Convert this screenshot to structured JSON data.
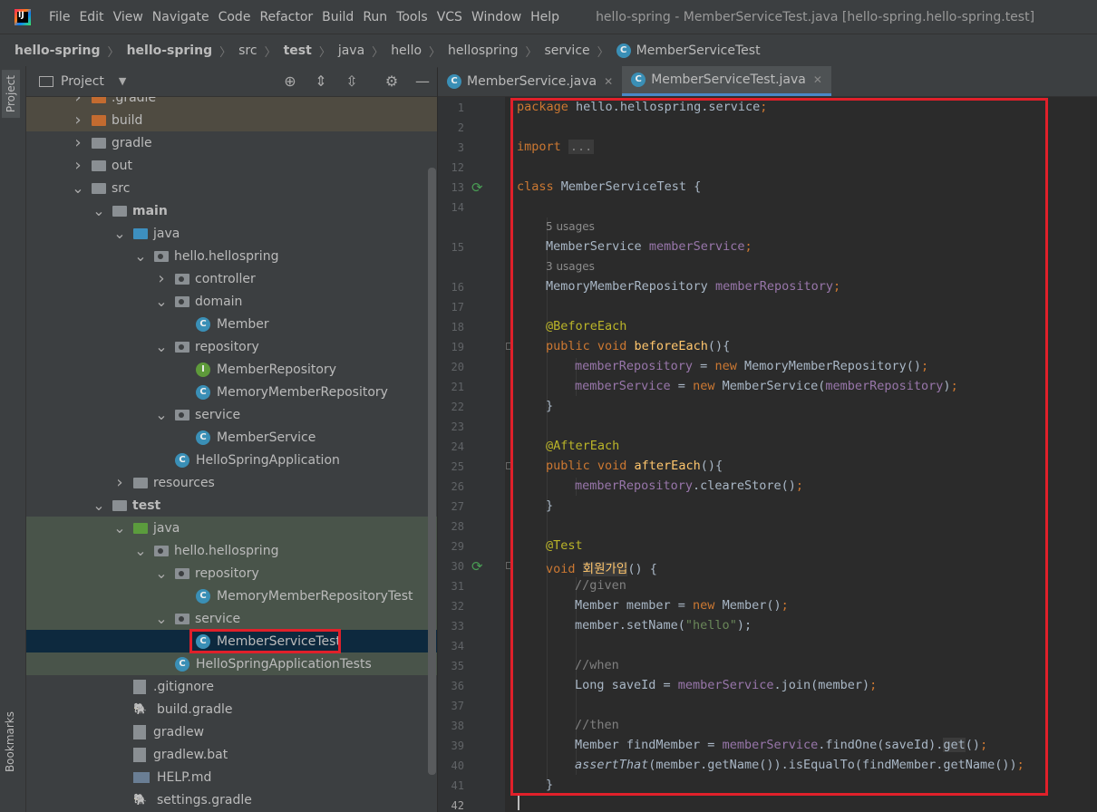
{
  "menu": {
    "items": [
      "File",
      "Edit",
      "View",
      "Navigate",
      "Code",
      "Refactor",
      "Build",
      "Run",
      "Tools",
      "VCS",
      "Window",
      "Help"
    ],
    "title": "hello-spring - MemberServiceTest.java [hello-spring.hello-spring.test]"
  },
  "breadcrumb": [
    "hello-spring",
    "hello-spring",
    "src",
    "test",
    "java",
    "hello",
    "hellospring",
    "service",
    "MemberServiceTest"
  ],
  "sidebar_tabs": {
    "project": "Project",
    "bookmarks": "Bookmarks"
  },
  "project_panel": {
    "title": "Project"
  },
  "tree": [
    {
      "label": ".gradle",
      "depth": 0,
      "icon": "folder-orange",
      "chev": "right",
      "bg": "excluded"
    },
    {
      "label": "build",
      "depth": 0,
      "icon": "folder-orange",
      "chev": "right",
      "bg": "excluded"
    },
    {
      "label": "gradle",
      "depth": 0,
      "icon": "folder",
      "chev": "right"
    },
    {
      "label": "out",
      "depth": 0,
      "icon": "folder",
      "chev": "right"
    },
    {
      "label": "src",
      "depth": 0,
      "icon": "folder",
      "chev": "down"
    },
    {
      "label": "main",
      "depth": 1,
      "icon": "folder-module",
      "chev": "down",
      "bold": true
    },
    {
      "label": "java",
      "depth": 2,
      "icon": "folder-blue",
      "chev": "down"
    },
    {
      "label": "hello.hellospring",
      "depth": 3,
      "icon": "package",
      "chev": "down"
    },
    {
      "label": "controller",
      "depth": 4,
      "icon": "package",
      "chev": "right"
    },
    {
      "label": "domain",
      "depth": 4,
      "icon": "package",
      "chev": "down"
    },
    {
      "label": "Member",
      "depth": 5,
      "icon": "class"
    },
    {
      "label": "repository",
      "depth": 4,
      "icon": "package",
      "chev": "down"
    },
    {
      "label": "MemberRepository",
      "depth": 5,
      "icon": "interface"
    },
    {
      "label": "MemoryMemberRepository",
      "depth": 5,
      "icon": "class"
    },
    {
      "label": "service",
      "depth": 4,
      "icon": "package",
      "chev": "down"
    },
    {
      "label": "MemberService",
      "depth": 5,
      "icon": "class"
    },
    {
      "label": "HelloSpringApplication",
      "depth": 4,
      "icon": "spring-class"
    },
    {
      "label": "resources",
      "depth": 2,
      "icon": "folder-res",
      "chev": "right"
    },
    {
      "label": "test",
      "depth": 1,
      "icon": "folder-module",
      "chev": "down",
      "bold": true
    },
    {
      "label": "java",
      "depth": 2,
      "icon": "folder-green",
      "chev": "down",
      "bg": "test"
    },
    {
      "label": "hello.hellospring",
      "depth": 3,
      "icon": "package",
      "chev": "down",
      "bg": "test"
    },
    {
      "label": "repository",
      "depth": 4,
      "icon": "package",
      "chev": "down",
      "bg": "test"
    },
    {
      "label": "MemoryMemberRepositoryTest",
      "depth": 5,
      "icon": "test-class",
      "bg": "test"
    },
    {
      "label": "service",
      "depth": 4,
      "icon": "package",
      "chev": "down",
      "bg": "test"
    },
    {
      "label": "MemberServiceTest",
      "depth": 5,
      "icon": "test-class",
      "bg": "selected",
      "boxed": true
    },
    {
      "label": "HelloSpringApplicationTests",
      "depth": 4,
      "icon": "test-class",
      "bg": "test"
    },
    {
      "label": ".gitignore",
      "depth": 2,
      "icon": "file"
    },
    {
      "label": "build.gradle",
      "depth": 2,
      "icon": "gradle"
    },
    {
      "label": "gradlew",
      "depth": 2,
      "icon": "file-exec"
    },
    {
      "label": "gradlew.bat",
      "depth": 2,
      "icon": "file"
    },
    {
      "label": "HELP.md",
      "depth": 2,
      "icon": "md"
    },
    {
      "label": "settings.gradle",
      "depth": 2,
      "icon": "gradle"
    }
  ],
  "tabs": [
    {
      "label": "MemberService.java",
      "active": false
    },
    {
      "label": "MemberServiceTest.java",
      "active": true
    }
  ],
  "editor": {
    "line_numbers": [
      "1",
      "2",
      "3",
      "12",
      "13",
      "14",
      "15",
      "16",
      "17",
      "18",
      "19",
      "20",
      "21",
      "22",
      "23",
      "24",
      "25",
      "26",
      "27",
      "28",
      "29",
      "30",
      "31",
      "32",
      "33",
      "34",
      "35",
      "36",
      "37",
      "38",
      "39",
      "40",
      "41",
      "42"
    ],
    "usage_hints": [
      "5 usages",
      "3 usages"
    ],
    "lines": {
      "l1": "package hello.hellospring.service;",
      "l3_kw": "import",
      "l3_fold": "...",
      "l13_kw": "class",
      "l13_name": "MemberServiceTest {",
      "l15_type": "MemberService",
      "l15_field": "memberService",
      "l16_type": "MemoryMemberRepository",
      "l16_field": "memberRepository",
      "l18": "@BeforeEach",
      "l19_kw": "public void",
      "l19_fn": "beforeEach",
      "l19_rest": "(){",
      "l20_field": "memberRepository",
      "l20_rest": " = ",
      "l20_kw": "new",
      "l20_call": " MemoryMemberRepository()",
      "l21_field": "memberService",
      "l21_call": " MemberService(",
      "l21_arg": "memberRepository",
      "l22": "}",
      "l24": "@AfterEach",
      "l25_fn": "afterEach",
      "l26_call": ".cleareStore()",
      "l29": "@Test",
      "l30_kw": "void",
      "l30_fn": "회원가입",
      "l30_rest": "() {",
      "l31": "//given",
      "l32_a": "Member member = ",
      "l32_c": " Member()",
      "l33_a": "member.setName(",
      "l33_s": "\"hello\"",
      "l33_b": ");",
      "l35": "//when",
      "l36_a": "Long saveId = ",
      "l36_c": ".join(member)",
      "l38": "//then",
      "l39_a": "Member findMember = ",
      "l39_c": ".findOne(saveId).",
      "l39_get": "get",
      "l39_d": "()",
      "l40_a": "assertThat",
      "l40_b": "(member.getName()).isEqualTo(findMember.getName())",
      "l41": "}"
    }
  },
  "colors": {
    "highlight_box": "#e0202a",
    "accent": "#4a88c7"
  }
}
